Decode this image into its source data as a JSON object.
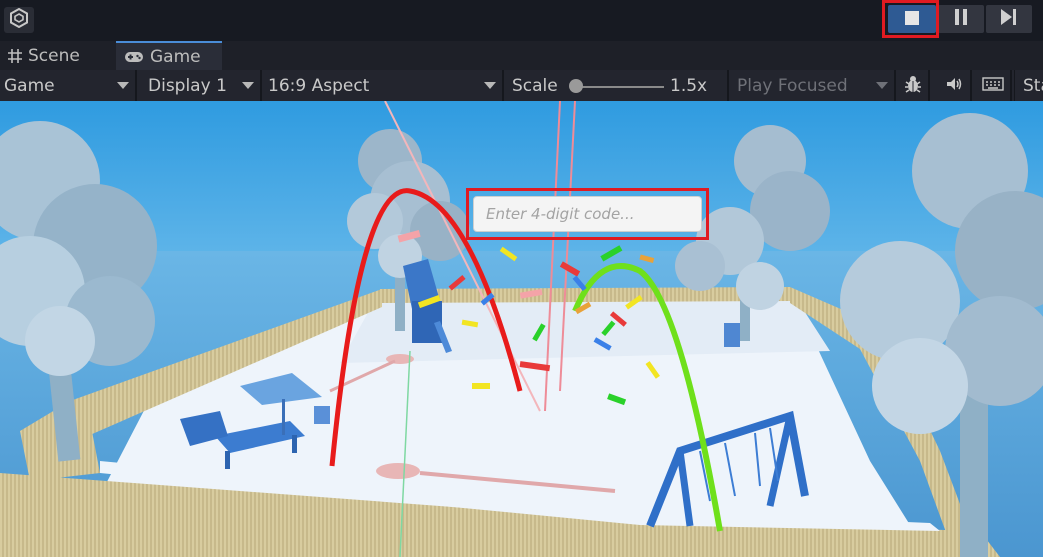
{
  "topbar": {
    "controls": {
      "stop": "stop",
      "pause": "pause",
      "step": "step"
    }
  },
  "tabs": [
    {
      "label": "Scene",
      "icon": "grid-icon"
    },
    {
      "label": "Game",
      "icon": "gamepad-icon",
      "active": true
    }
  ],
  "game_toolbar": {
    "view_mode": "Game",
    "display": "Display 1",
    "aspect": "16:9 Aspect",
    "scale_label": "Scale",
    "scale_value": "1.5x",
    "scale_fraction": 0.0,
    "play_mode": "Play Focused",
    "stats_label": "Sta"
  },
  "game": {
    "code_placeholder": "Enter 4-digit code..."
  },
  "colors": {
    "accent_blue": "#2e5a93",
    "highlight_red": "#e01b22",
    "arc_red": "#e81b1b",
    "arc_green": "#6fe01b"
  }
}
